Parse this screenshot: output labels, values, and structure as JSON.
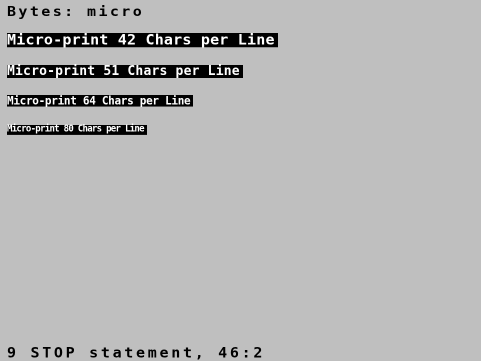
{
  "screen": {
    "header_text": "Bytes: micro",
    "lines": [
      {
        "text": "Micro-print 42 Chars per Line"
      },
      {
        "text": "Micro-print 51 Chars per Line"
      },
      {
        "text": "Micro-print 64 Chars per Line"
      },
      {
        "text": "Micro-print 80 Chars per Line"
      }
    ],
    "status_text": "9 STOP statement, 46:2"
  },
  "colors": {
    "screen_background": "#bfbfbf",
    "ink": "#000000",
    "paper_inverse": "#ffffff"
  }
}
